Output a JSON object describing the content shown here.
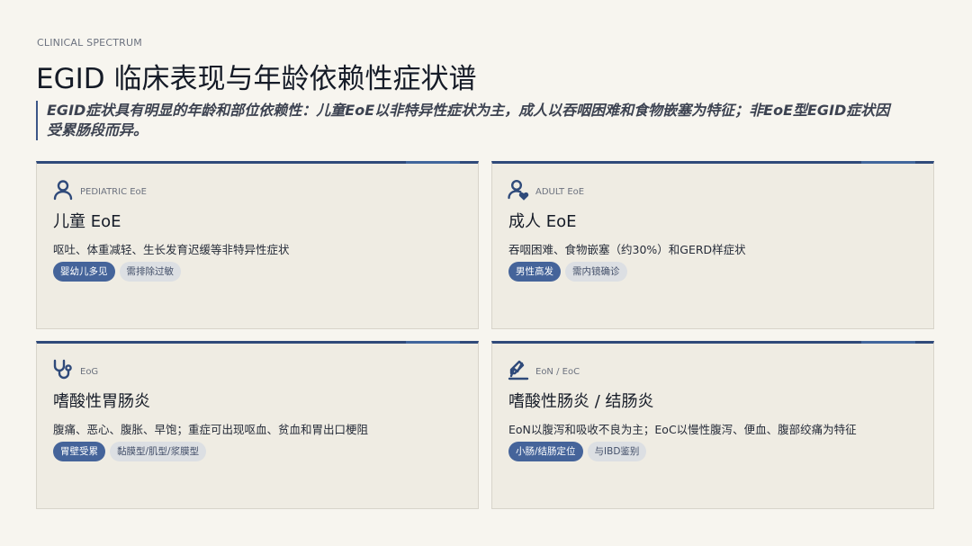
{
  "header": {
    "eyebrow": "CLINICAL SPECTRUM",
    "title": "EGID 临床表现与年龄依赖性症状谱",
    "subtitle": "EGID症状具有明显的年龄和部位依赖性：儿童EoE以非特异性症状为主，成人以吞咽困难和食物嵌塞为特征；非EoE型EGID症状因受累肠段而异。"
  },
  "colors": {
    "accent": "#2f4a7a",
    "chip_primary": "#45649a",
    "chip_secondary": "#dcdfe3",
    "card_bg": "#efece3",
    "page_bg": "#f7f5ef"
  },
  "cards": [
    {
      "icon": "person-icon",
      "tag": "PEDIATRIC EoE",
      "title": "儿童 EoE",
      "description": "呕吐、体重减轻、生长发育迟缓等非特异性症状",
      "chips": [
        "婴幼儿多见",
        "需排除过敏"
      ]
    },
    {
      "icon": "person-heart-icon",
      "tag": "ADULT EoE",
      "title": "成人 EoE",
      "description": "吞咽困难、食物嵌塞（约30%）和GERD样症状",
      "chips": [
        "男性高发",
        "需内镜确诊"
      ]
    },
    {
      "icon": "stethoscope-icon",
      "tag": "EoG",
      "title": "嗜酸性胃肠炎",
      "description": "腹痛、恶心、腹胀、早饱；重症可出现呕血、贫血和胃出口梗阻",
      "chips": [
        "胃壁受累",
        "黏膜型/肌型/浆膜型"
      ]
    },
    {
      "icon": "report-icon",
      "tag": "EoN / EoC",
      "title": "嗜酸性肠炎 / 结肠炎",
      "description": "EoN以腹泻和吸收不良为主；EoC以慢性腹泻、便血、腹部绞痛为特征",
      "chips": [
        "小肠/结肠定位",
        "与IBD鉴别"
      ]
    }
  ]
}
